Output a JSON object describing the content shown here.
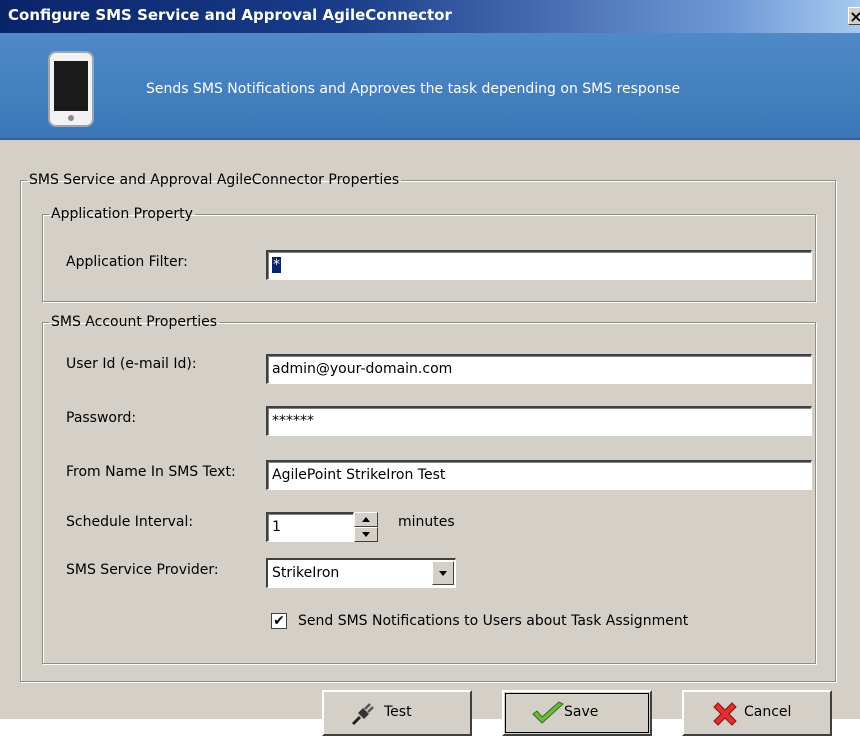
{
  "window": {
    "title": "Configure SMS Service and Approval AgileConnector",
    "close_label": "×"
  },
  "banner": {
    "description": "Sends SMS Notifications and Approves the task depending on SMS response",
    "icon": "mobile-phone-icon"
  },
  "main_group": {
    "legend": "SMS Service and Approval AgileConnector Properties"
  },
  "application_group": {
    "legend": "Application Property",
    "filter_label": "Application Filter:",
    "filter_value": "*"
  },
  "sms_group": {
    "legend": "SMS Account Properties",
    "user_id_label": "User Id (e-mail Id):",
    "user_id_value": "admin@your-domain.com",
    "password_label": "Password:",
    "password_value": "******",
    "from_name_label": "From Name In SMS Text:",
    "from_name_value": "AgilePoint StrikeIron Test",
    "interval_label": "Schedule Interval:",
    "interval_value": "1",
    "interval_unit": "minutes",
    "provider_label": "SMS Service Provider:",
    "provider_value": "StrikeIron",
    "notify_label": "Send SMS Notifications to Users about Task Assignment",
    "notify_checked": true,
    "check_mark": "✔"
  },
  "buttons": {
    "test_label": "Test",
    "save_label": "Save",
    "cancel_label": "Cancel"
  },
  "colors": {
    "title_bar": "#0a246a",
    "banner": "#4f89c7",
    "dialog_bg": "#d4d0c8"
  }
}
